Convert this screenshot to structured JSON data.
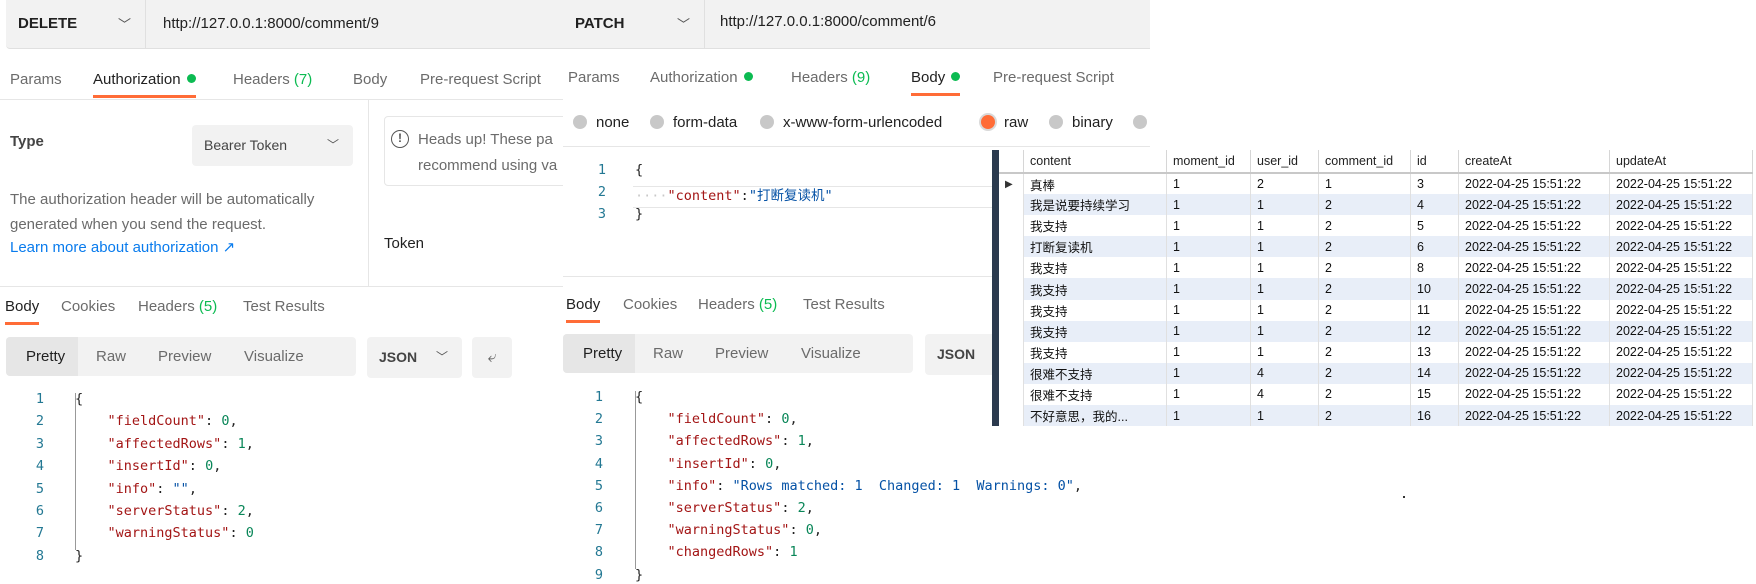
{
  "colors": {
    "accent": "#ff6c37",
    "status_dot": "#0cbb52",
    "json_key": "#a31515",
    "json_number": "#098658",
    "json_string": "#0451a5"
  },
  "left": {
    "method": "DELETE",
    "url": "http://127.0.0.1:8000/comment/9",
    "tabs": [
      {
        "label": "Params"
      },
      {
        "label": "Authorization",
        "dot": true,
        "active": true
      },
      {
        "label": "Headers",
        "count": "(7)"
      },
      {
        "label": "Body"
      },
      {
        "label": "Pre-request Script"
      }
    ],
    "auth": {
      "type_label": "Type",
      "type_value": "Bearer Token",
      "desc_line1": "The authorization header will be automatically",
      "desc_line2": "generated when you send the request.",
      "learn_more": "Learn more about authorization ↗",
      "headsup_line1": "Heads up! These pa",
      "headsup_line2": "recommend using va",
      "token_label": "Token"
    },
    "response_tabs": [
      {
        "label": "Body",
        "active": true
      },
      {
        "label": "Cookies"
      },
      {
        "label": "Headers",
        "count": "(5)"
      },
      {
        "label": "Test Results"
      }
    ],
    "view_modes": [
      "Pretty",
      "Raw",
      "Preview",
      "Visualize"
    ],
    "format": "JSON",
    "response_lines": [
      [
        [
          "p",
          "{"
        ]
      ],
      [
        [
          "k",
          "    \"fieldCount\""
        ],
        [
          "p",
          ": "
        ],
        [
          "n",
          "0"
        ],
        [
          "p",
          ","
        ]
      ],
      [
        [
          "k",
          "    \"affectedRows\""
        ],
        [
          "p",
          ": "
        ],
        [
          "n",
          "1"
        ],
        [
          "p",
          ","
        ]
      ],
      [
        [
          "k",
          "    \"insertId\""
        ],
        [
          "p",
          ": "
        ],
        [
          "n",
          "0"
        ],
        [
          "p",
          ","
        ]
      ],
      [
        [
          "k",
          "    \"info\""
        ],
        [
          "p",
          ": "
        ],
        [
          "s",
          "\"\""
        ],
        [
          "p",
          ","
        ]
      ],
      [
        [
          "k",
          "    \"serverStatus\""
        ],
        [
          "p",
          ": "
        ],
        [
          "n",
          "2"
        ],
        [
          "p",
          ","
        ]
      ],
      [
        [
          "k",
          "    \"warningStatus\""
        ],
        [
          "p",
          ": "
        ],
        [
          "n",
          "0"
        ]
      ],
      [
        [
          "p",
          "}"
        ]
      ]
    ]
  },
  "middle": {
    "method": "PATCH",
    "url": "http://127.0.0.1:8000/comment/6",
    "tabs": [
      {
        "label": "Params"
      },
      {
        "label": "Authorization",
        "dot": true
      },
      {
        "label": "Headers",
        "count": "(9)"
      },
      {
        "label": "Body",
        "dot": true,
        "active": true
      },
      {
        "label": "Pre-request Script"
      }
    ],
    "body_types": [
      {
        "label": "none"
      },
      {
        "label": "form-data"
      },
      {
        "label": "x-www-form-urlencoded"
      },
      {
        "label": "raw",
        "selected": true
      },
      {
        "label": "binary"
      }
    ],
    "request_lines": [
      [
        [
          "p",
          "{"
        ]
      ],
      [
        [
          "w",
          "····"
        ],
        [
          "k",
          "\"content\""
        ],
        [
          "p",
          ":"
        ],
        [
          "s",
          "\"打断复读机\""
        ]
      ],
      [
        [
          "p",
          "}"
        ]
      ]
    ],
    "response_tabs": [
      {
        "label": "Body",
        "active": true
      },
      {
        "label": "Cookies"
      },
      {
        "label": "Headers",
        "count": "(5)"
      },
      {
        "label": "Test Results"
      }
    ],
    "view_modes": [
      "Pretty",
      "Raw",
      "Preview",
      "Visualize"
    ],
    "format": "JSON",
    "response_lines": [
      [
        [
          "p",
          "{"
        ]
      ],
      [
        [
          "k",
          "    \"fieldCount\""
        ],
        [
          "p",
          ": "
        ],
        [
          "n",
          "0"
        ],
        [
          "p",
          ","
        ]
      ],
      [
        [
          "k",
          "    \"affectedRows\""
        ],
        [
          "p",
          ": "
        ],
        [
          "n",
          "1"
        ],
        [
          "p",
          ","
        ]
      ],
      [
        [
          "k",
          "    \"insertId\""
        ],
        [
          "p",
          ": "
        ],
        [
          "n",
          "0"
        ],
        [
          "p",
          ","
        ]
      ],
      [
        [
          "k",
          "    \"info\""
        ],
        [
          "p",
          ": "
        ],
        [
          "s",
          "\"Rows matched: 1  Changed: 1  Warnings: 0\""
        ],
        [
          "p",
          ","
        ]
      ],
      [
        [
          "k",
          "    \"serverStatus\""
        ],
        [
          "p",
          ": "
        ],
        [
          "n",
          "2"
        ],
        [
          "p",
          ","
        ]
      ],
      [
        [
          "k",
          "    \"warningStatus\""
        ],
        [
          "p",
          ": "
        ],
        [
          "n",
          "0"
        ],
        [
          "p",
          ","
        ]
      ],
      [
        [
          "k",
          "    \"changedRows\""
        ],
        [
          "p",
          ": "
        ],
        [
          "n",
          "1"
        ]
      ],
      [
        [
          "p",
          "}"
        ]
      ]
    ]
  },
  "table": {
    "columns": [
      "content",
      "moment_id",
      "user_id",
      "comment_id",
      "id",
      "createAt",
      "updateAt"
    ],
    "rows": [
      [
        "真棒",
        "1",
        "2",
        "1",
        "3",
        "2022-04-25 15:51:22",
        "2022-04-25 15:51:22"
      ],
      [
        "我是说要持续学习",
        "1",
        "1",
        "2",
        "4",
        "2022-04-25 15:51:22",
        "2022-04-25 15:51:22"
      ],
      [
        "我支持",
        "1",
        "1",
        "2",
        "5",
        "2022-04-25 15:51:22",
        "2022-04-25 15:51:22"
      ],
      [
        "打断复读机",
        "1",
        "1",
        "2",
        "6",
        "2022-04-25 15:51:22",
        "2022-04-25 15:51:22"
      ],
      [
        "我支持",
        "1",
        "1",
        "2",
        "8",
        "2022-04-25 15:51:22",
        "2022-04-25 15:51:22"
      ],
      [
        "我支持",
        "1",
        "1",
        "2",
        "10",
        "2022-04-25 15:51:22",
        "2022-04-25 15:51:22"
      ],
      [
        "我支持",
        "1",
        "1",
        "2",
        "11",
        "2022-04-25 15:51:22",
        "2022-04-25 15:51:22"
      ],
      [
        "我支持",
        "1",
        "1",
        "2",
        "12",
        "2022-04-25 15:51:22",
        "2022-04-25 15:51:22"
      ],
      [
        "我支持",
        "1",
        "1",
        "2",
        "13",
        "2022-04-25 15:51:22",
        "2022-04-25 15:51:22"
      ],
      [
        "很难不支持",
        "1",
        "4",
        "2",
        "14",
        "2022-04-25 15:51:22",
        "2022-04-25 15:51:22"
      ],
      [
        "很难不支持",
        "1",
        "4",
        "2",
        "15",
        "2022-04-25 15:51:22",
        "2022-04-25 15:51:22"
      ],
      [
        "不好意思，我的...",
        "1",
        "1",
        "2",
        "16",
        "2022-04-25 15:51:22",
        "2022-04-25 15:51:22"
      ]
    ]
  }
}
